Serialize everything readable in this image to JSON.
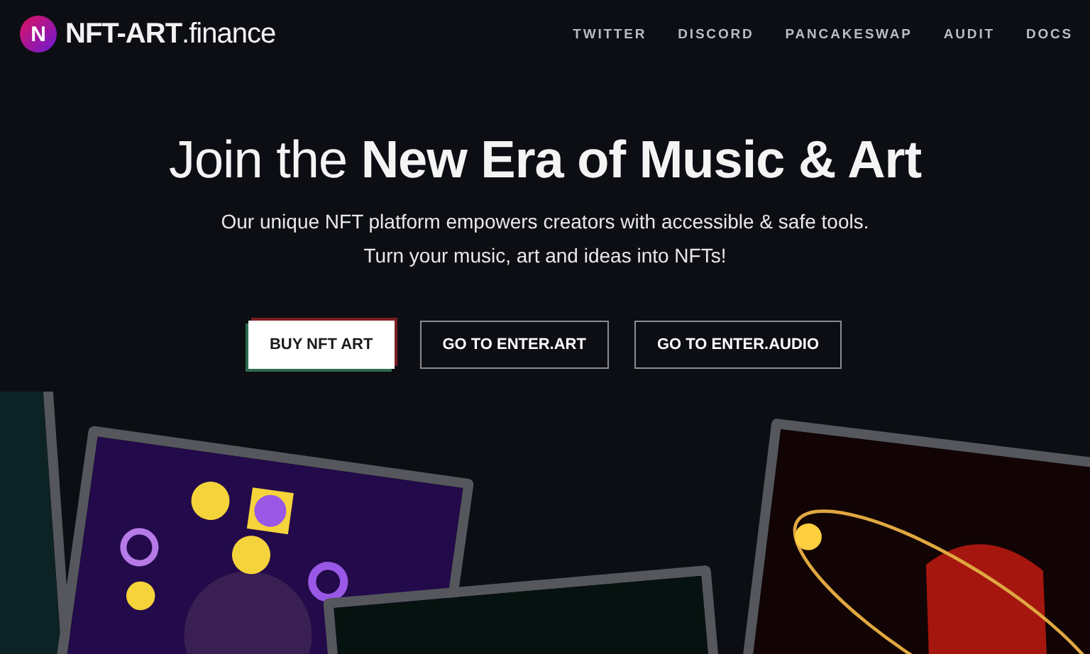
{
  "header": {
    "logo_mark": "N",
    "logo_text": "NFT-ART",
    "logo_suffix": ".finance",
    "nav": [
      "TWITTER",
      "DISCORD",
      "PANCAKESWAP",
      "AUDIT",
      "DOCS"
    ]
  },
  "hero": {
    "headline": "Join the **New Era of Music & Art**",
    "subtitle_lines": [
      "Our unique NFT platform empowers creators with accessible & safe tools.",
      "Turn your music, art and ideas into NFTs!"
    ],
    "buttons": [
      {
        "label": "BUY NFT ART",
        "kind": "primary"
      },
      {
        "label": "GO TO ENTER.ART",
        "kind": "outline"
      },
      {
        "label": "GO TO ENTER.AUDIO",
        "kind": "outline"
      }
    ]
  },
  "artworks": [
    {
      "kind": "edge"
    },
    {
      "kind": "shapes"
    },
    {
      "kind": "dark"
    },
    {
      "kind": "orbit"
    }
  ]
}
